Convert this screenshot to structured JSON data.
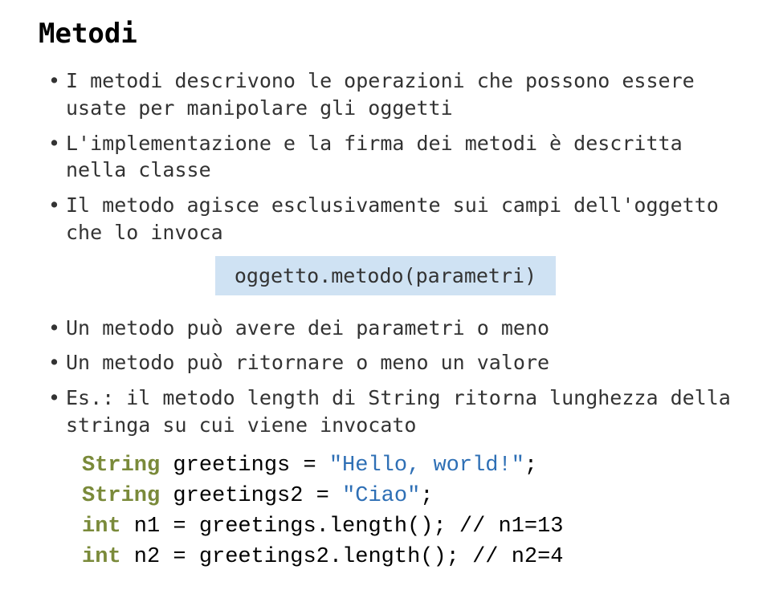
{
  "title": "Metodi",
  "bullets_top": [
    "I metodi descrivono le operazioni che possono essere usate per manipolare gli oggetti",
    "L'implementazione e la firma dei metodi è descritta nella classe",
    "Il metodo agisce esclusivamente sui campi dell'oggetto che lo invoca"
  ],
  "callout": "oggetto.metodo(parametri)",
  "bullets_bottom": [
    "Un metodo può avere dei parametri o meno",
    "Un metodo può ritornare o meno un valore",
    "Es.: il metodo length di String ritorna lunghezza della stringa su cui viene invocato"
  ],
  "code": {
    "line1_kw": "String",
    "line1_rest": " greetings = ",
    "line1_str": "\"Hello, world!\"",
    "line1_end": ";",
    "line2_kw": "String",
    "line2_rest": " greetings2 = ",
    "line2_str": "\"Ciao\"",
    "line2_end": ";",
    "line3_kw": "int",
    "line3_rest": " n1 = greetings.length(); // n1=13",
    "line4_kw": "int",
    "line4_rest": " n2 = greetings2.length(); // n2=4"
  }
}
